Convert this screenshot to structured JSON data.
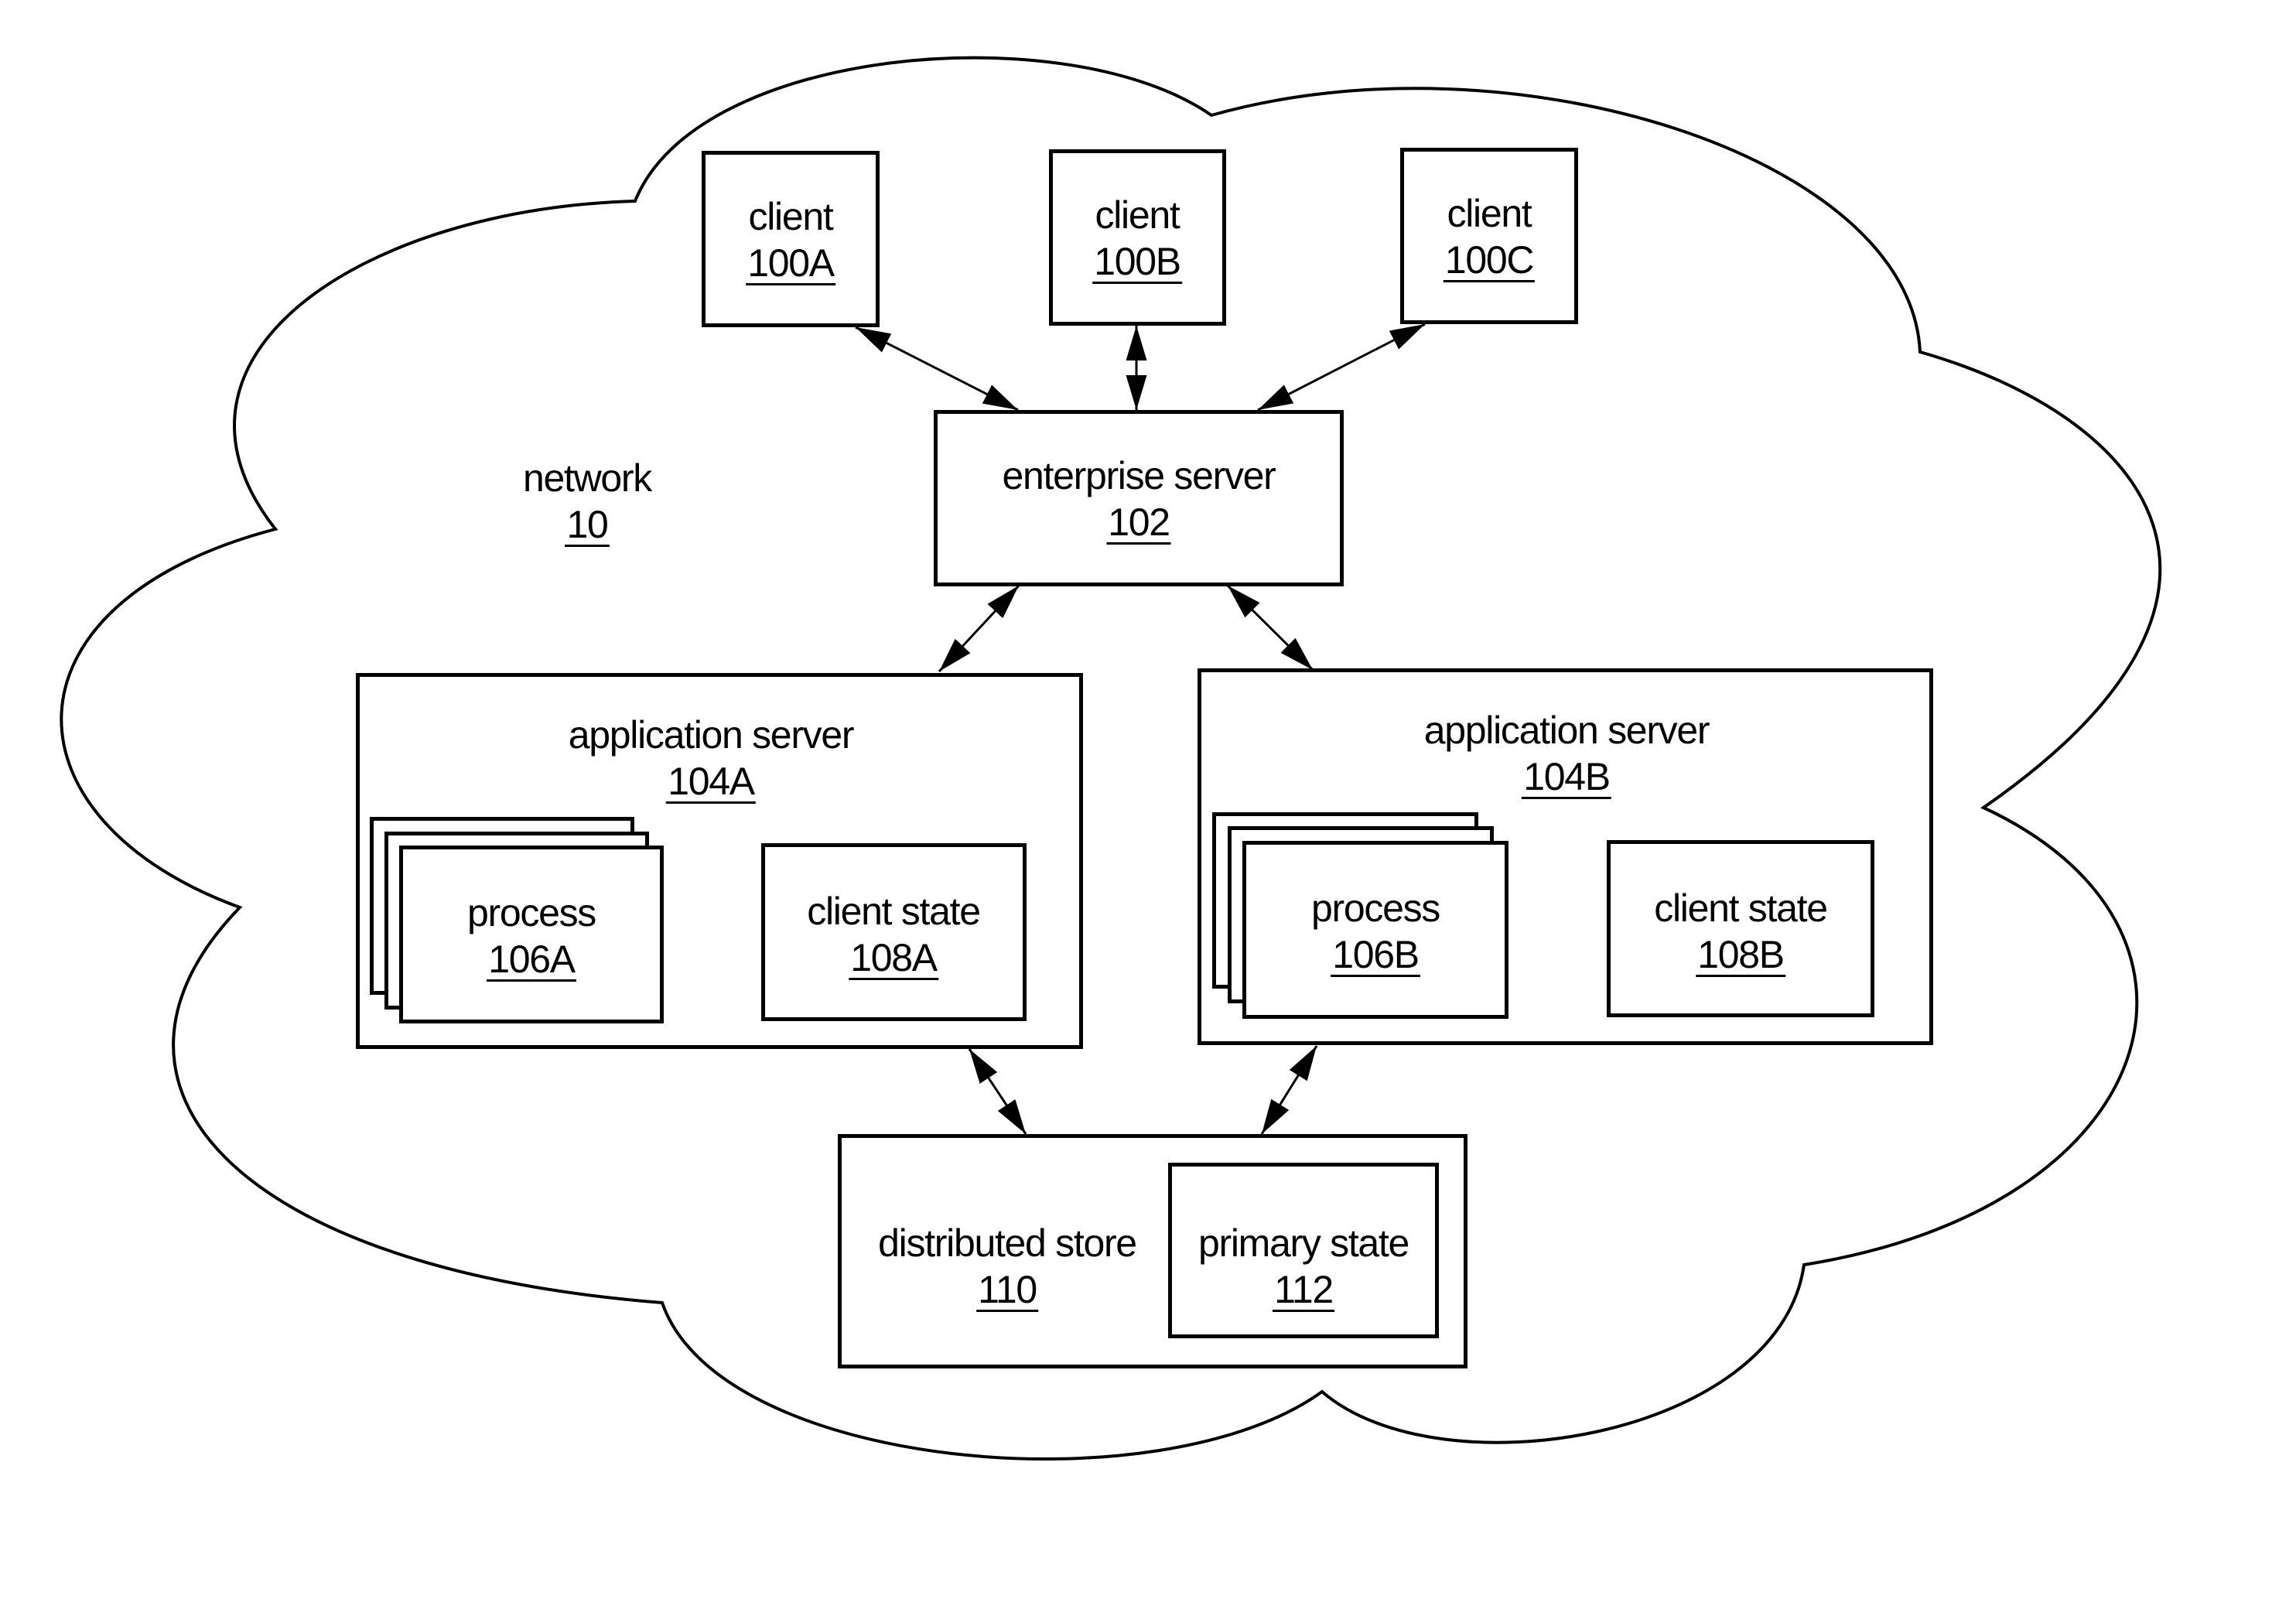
{
  "figure": {
    "network": {
      "label": "network",
      "ref": "10"
    },
    "clients": [
      {
        "label": "client",
        "ref": "100A"
      },
      {
        "label": "client",
        "ref": "100B"
      },
      {
        "label": "client",
        "ref": "100C"
      }
    ],
    "enterprise_server": {
      "label": "enterprise server",
      "ref": "102"
    },
    "application_servers": [
      {
        "label": "application server",
        "ref": "104A",
        "process": {
          "label": "process",
          "ref": "106A"
        },
        "client_state": {
          "label": "client state",
          "ref": "108A"
        }
      },
      {
        "label": "application server",
        "ref": "104B",
        "process": {
          "label": "process",
          "ref": "106B"
        },
        "client_state": {
          "label": "client state",
          "ref": "108B"
        }
      }
    ],
    "distributed_store": {
      "label": "distributed store",
      "ref": "110"
    },
    "primary_state": {
      "label": "primary state",
      "ref": "112"
    },
    "connections": [
      {
        "from": "client 100A",
        "to": "enterprise server 102",
        "type": "bidirectional"
      },
      {
        "from": "client 100B",
        "to": "enterprise server 102",
        "type": "bidirectional"
      },
      {
        "from": "client 100C",
        "to": "enterprise server 102",
        "type": "bidirectional"
      },
      {
        "from": "enterprise server 102",
        "to": "application server 104A",
        "type": "bidirectional"
      },
      {
        "from": "enterprise server 102",
        "to": "application server 104B",
        "type": "bidirectional"
      },
      {
        "from": "application server 104A",
        "to": "distributed store 110",
        "type": "bidirectional"
      },
      {
        "from": "application server 104B",
        "to": "distributed store 110",
        "type": "bidirectional"
      }
    ]
  }
}
